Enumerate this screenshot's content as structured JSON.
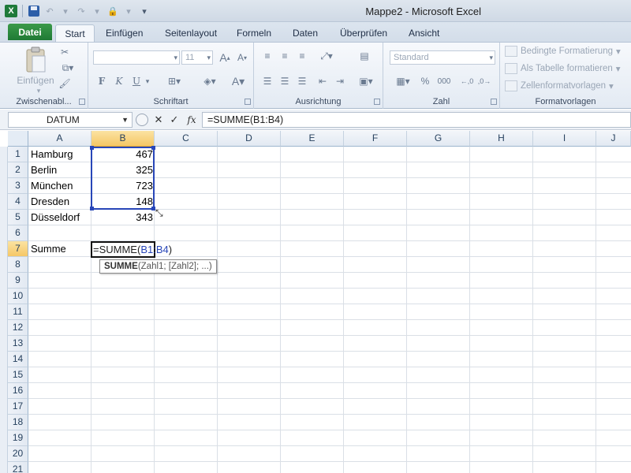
{
  "window": {
    "title": "Mappe2  -  Microsoft Excel"
  },
  "tabs": [
    {
      "label": "Datei"
    },
    {
      "label": "Start"
    },
    {
      "label": "Einfügen"
    },
    {
      "label": "Seitenlayout"
    },
    {
      "label": "Formeln"
    },
    {
      "label": "Daten"
    },
    {
      "label": "Überprüfen"
    },
    {
      "label": "Ansicht"
    }
  ],
  "ribbon": {
    "clipboard": {
      "paste_label": "Einfügen",
      "group_label": "Zwischenabl..."
    },
    "font": {
      "group_label": "Schriftart",
      "size_value": "11",
      "bold": "F",
      "italic": "K",
      "underline": "U"
    },
    "alignment": {
      "group_label": "Ausrichtung"
    },
    "number": {
      "group_label": "Zahl",
      "format_value": "Standard",
      "percent": "%",
      "thousands": "000"
    },
    "styles": {
      "group_label": "Formatvorlagen",
      "conditional": "Bedingte Formatierung",
      "as_table": "Als Tabelle formatieren",
      "cell_styles": "Zellenformatvorlagen"
    }
  },
  "formula_bar": {
    "name_box": "DATUM",
    "formula": "=SUMME(B1:B4)",
    "fx": "fx"
  },
  "grid": {
    "columns": [
      "A",
      "B",
      "C",
      "D",
      "E",
      "F",
      "G",
      "H",
      "I",
      "J"
    ],
    "selected_column": "B",
    "rows": [
      "1",
      "2",
      "3",
      "4",
      "5",
      "6",
      "7",
      "8",
      "9",
      "10",
      "11",
      "12",
      "13",
      "14",
      "15",
      "16",
      "17",
      "18",
      "19",
      "20",
      "21"
    ],
    "selected_row": "7",
    "cells": [
      {
        "row": 1,
        "col": "A",
        "value": "Hamburg"
      },
      {
        "row": 1,
        "col": "B",
        "value": "467"
      },
      {
        "row": 2,
        "col": "A",
        "value": "Berlin"
      },
      {
        "row": 2,
        "col": "B",
        "value": "325"
      },
      {
        "row": 3,
        "col": "A",
        "value": "München"
      },
      {
        "row": 3,
        "col": "B",
        "value": "723"
      },
      {
        "row": 4,
        "col": "A",
        "value": "Dresden"
      },
      {
        "row": 4,
        "col": "B",
        "value": "148"
      },
      {
        "row": 5,
        "col": "A",
        "value": "Düsseldorf"
      },
      {
        "row": 5,
        "col": "B",
        "value": "343"
      },
      {
        "row": 7,
        "col": "A",
        "value": "Summe"
      }
    ],
    "edit_cell": {
      "prefix": "=SUMME(",
      "ref": "B1:B4",
      "suffix": ")"
    },
    "tooltip": {
      "func": "SUMME",
      "args": "(Zahl1; [Zahl2]; ...)"
    }
  }
}
